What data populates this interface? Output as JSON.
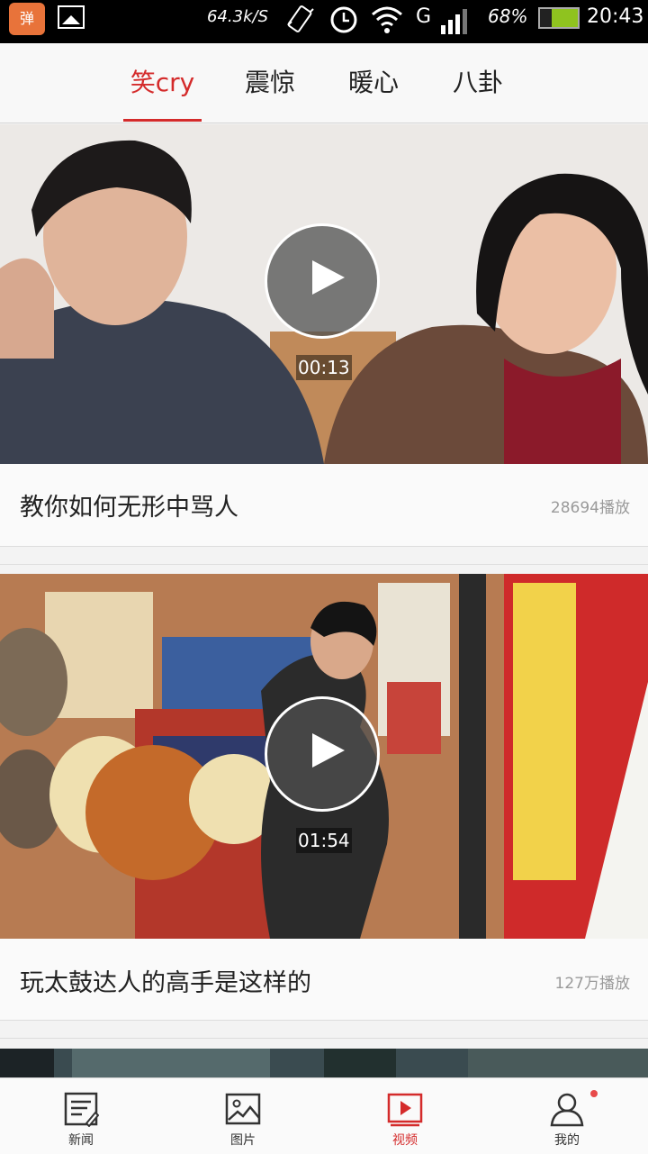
{
  "status_bar": {
    "app_badge": "弹",
    "net_speed": "64.3k/S",
    "network": "G",
    "battery": "68",
    "battery_suffix": "%",
    "battery_level": 0.68,
    "time": "20:43"
  },
  "tabs": [
    {
      "label": "笑cry",
      "active": true
    },
    {
      "label": "震惊",
      "active": false
    },
    {
      "label": "暖心",
      "active": false
    },
    {
      "label": "八卦",
      "active": false
    }
  ],
  "videos": [
    {
      "title": "教你如何无形中骂人",
      "duration": "00:13",
      "plays": "28694播放"
    },
    {
      "title": "玩太鼓达人的高手是这样的",
      "duration": "01:54",
      "plays": "127万播放"
    }
  ],
  "bottom_nav": [
    {
      "label": "新闻",
      "icon": "news-icon",
      "active": false
    },
    {
      "label": "图片",
      "icon": "picture-icon",
      "active": false
    },
    {
      "label": "视频",
      "icon": "video-icon",
      "active": true
    },
    {
      "label": "我的",
      "icon": "profile-icon",
      "active": false
    }
  ],
  "colors": {
    "accent": "#d42b2b",
    "status_bar": "#000000",
    "battery_fill": "#8fc31f"
  }
}
